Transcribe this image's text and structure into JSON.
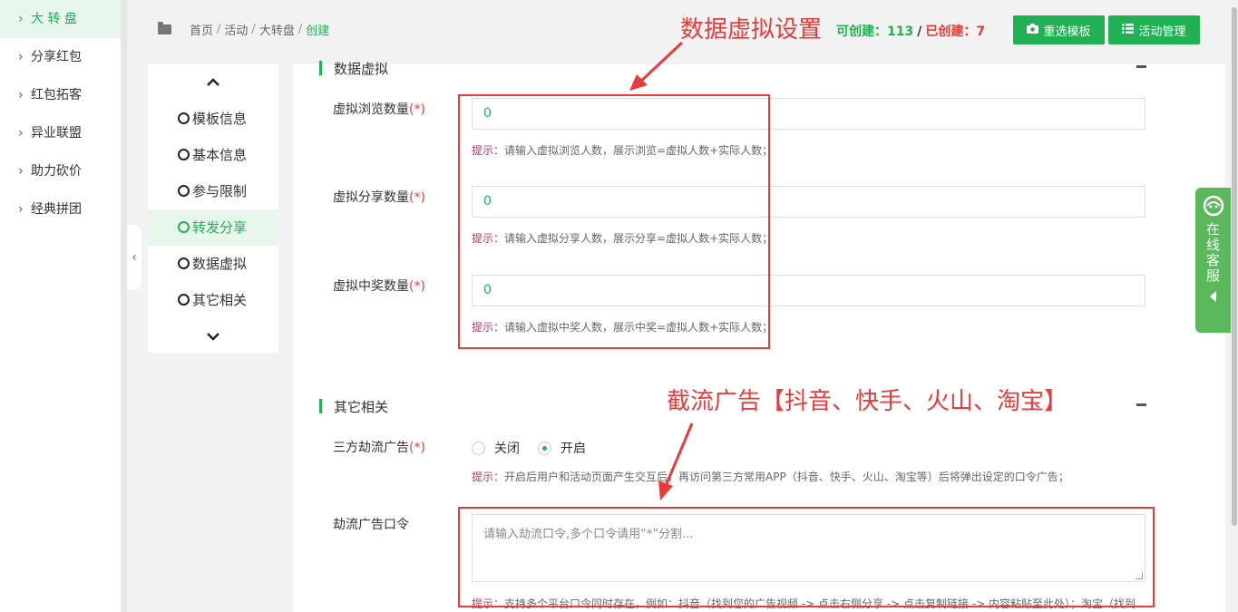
{
  "left_nav": {
    "items": [
      {
        "label": "大 转 盘",
        "active": true
      },
      {
        "label": "分享红包"
      },
      {
        "label": "红包拓客"
      },
      {
        "label": "异业联盟"
      },
      {
        "label": "助力砍价"
      },
      {
        "label": "经典拼团"
      }
    ]
  },
  "breadcrumb": {
    "items": [
      "首页",
      "活动",
      "大转盘"
    ],
    "current": "创建"
  },
  "counts": {
    "can_create_label": "可创建：113",
    "created_label": "已创建：7"
  },
  "buttons": {
    "reselect_template": "重选模板",
    "activity_manage": "活动管理"
  },
  "steps": {
    "items": [
      "模板信息",
      "基本信息",
      "参与限制",
      "转发分享",
      "数据虚拟",
      "其它相关"
    ],
    "active": "转发分享"
  },
  "sections": {
    "virtual": {
      "title": "数据虚拟",
      "fields": [
        {
          "label": "虚拟浏览数量",
          "required": "(*)",
          "value": "0",
          "hint_key": "提示：",
          "hint": "请输入虚拟浏览人数，展示浏览=虚拟人数+实际人数；"
        },
        {
          "label": "虚拟分享数量",
          "required": "(*)",
          "value": "0",
          "hint_key": "提示：",
          "hint": "请输入虚拟分享人数，展示分享=虚拟人数+实际人数；"
        },
        {
          "label": "虚拟中奖数量",
          "required": "(*)",
          "value": "0",
          "hint_key": "提示：",
          "hint": "请输入虚拟中奖人数，展示中奖=虚拟人数+实际人数；"
        }
      ]
    },
    "other": {
      "title": "其它相关",
      "flow_ad": {
        "label": "三方劫流广告",
        "required": "(*)",
        "options": [
          "关闭",
          "开启"
        ],
        "selected": "开启",
        "hint_key": "提示：",
        "hint": "开启后用户和活动页面产生交互后，再访问第三方常用APP（抖音、快手、火山、淘宝等）后将弹出设定的口令广告；"
      },
      "command": {
        "label": "劫流广告口令",
        "placeholder": "请输入劫流口令,多个口令请用“*”分割...",
        "hint_key": "提示：",
        "hint": "支持多个平台口令同时存在，例如：抖音（找到您的广告视频 -> 点击右侧分享 -> 点击复制链接 -> 内容粘贴至此处）；淘宝（找到"
      }
    }
  },
  "annotations": {
    "virtual_settings": "数据虚拟设置",
    "flow_ads": "截流广告【抖音、快手、火山、淘宝】"
  },
  "service": {
    "label": "在线客服"
  },
  "colors": {
    "accent_green": "#1fb152",
    "annotation_red": "#e83b3b"
  }
}
